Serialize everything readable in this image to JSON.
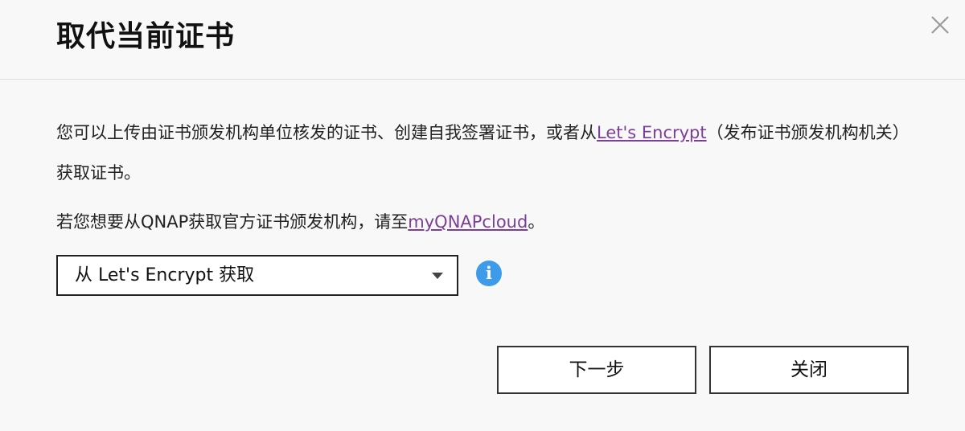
{
  "dialog": {
    "title": "取代当前证书",
    "close_icon": "close-icon"
  },
  "description": {
    "part1": "您可以上传由证书颁发机构单位核发的证书、创建自我签署证书，或者从",
    "link_letsencrypt": "Let's Encrypt",
    "part2": "（发布证书颁发机构机关）获取证书。"
  },
  "qnap_note": {
    "part1": "若您想要从QNAP获取官方证书颁发机构，请至",
    "link_myqnapcloud": "myQNAPcloud",
    "part2": "。"
  },
  "source_select": {
    "selected": "从 Let's Encrypt 获取",
    "info_icon": "info-icon"
  },
  "buttons": {
    "next": "下一步",
    "close": "关闭"
  },
  "colors": {
    "link": "#7b3f98",
    "info": "#3d9bea",
    "background": "#f8f8f8"
  }
}
